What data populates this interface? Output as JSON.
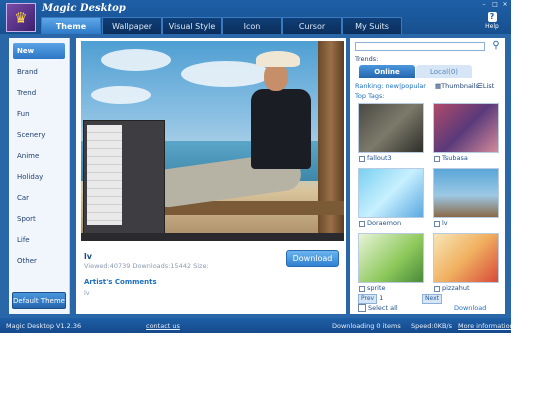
{
  "app": {
    "title": "Magic Desktop",
    "accent": "#2a67a9"
  },
  "tabs": [
    {
      "label": "Theme",
      "active": true
    },
    {
      "label": "Wallpaper"
    },
    {
      "label": "Visual Style"
    },
    {
      "label": "Icon"
    },
    {
      "label": "Cursor"
    },
    {
      "label": "My Suits"
    }
  ],
  "help": {
    "label": "Help",
    "icon": "question-icon"
  },
  "categories": [
    "New",
    "Brand",
    "Trend",
    "Fun",
    "Scenery",
    "Anime",
    "Holiday",
    "Car",
    "Sport",
    "Life",
    "Other"
  ],
  "selected_category": "New",
  "default_theme_label": "Default Theme",
  "detail": {
    "name": "lv",
    "stats": "Viewed:40739 Downloads:15442 Size:",
    "download_label": "Download",
    "comments_heading": "Artist's Comments",
    "comment": "lv"
  },
  "right": {
    "search_placeholder": "",
    "trends_label": "Trends:",
    "tabs": [
      "Online",
      "Local(0)"
    ],
    "ranking": "Ranking:  new|popular",
    "thumbnails_label": "Thumbnails",
    "list_label": "List",
    "top_tags_label": "Top Tags:",
    "thumbs": [
      {
        "label": "fallout3"
      },
      {
        "label": "Tsubasa"
      },
      {
        "label": "Doraemon"
      },
      {
        "label": "lv"
      },
      {
        "label": "sprite"
      },
      {
        "label": "pizzahut"
      }
    ],
    "prev_label": "Prev",
    "page": "1",
    "next_label": "Next",
    "select_all": "Select all",
    "download_label": "Download"
  },
  "status": {
    "version": "Magic Desktop V1.2.36",
    "contact": "contact us",
    "downloading": "Downloading 0 items",
    "speed": "Speed:0KB/s",
    "more_info": "More information"
  }
}
